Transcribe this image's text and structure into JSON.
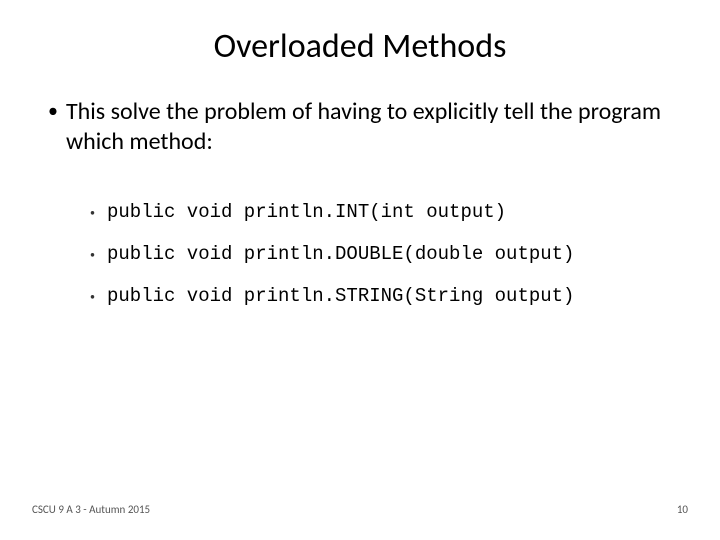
{
  "title": "Overloaded Methods",
  "mainBullet": "This solve the problem of having to explicitly tell the program which method:",
  "subBullets": [
    "public void println.INT(int output)",
    "public void println.DOUBLE(double output)",
    "public void println.STRING(String output)"
  ],
  "footerLeft": "CSCU 9 A 3 - Autumn 2015",
  "footerRight": "10"
}
